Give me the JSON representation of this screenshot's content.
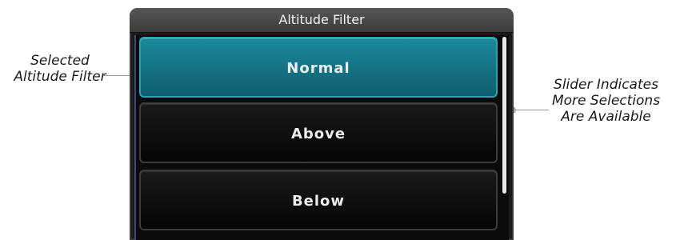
{
  "annotations": {
    "left_lines": [
      "Selected",
      "Altitude Filter"
    ],
    "right_lines": [
      "Slider Indicates",
      "More Selections",
      "Are Available"
    ]
  },
  "dialog": {
    "title": "Altitude Filter",
    "options": [
      {
        "label": "Normal",
        "selected": true
      },
      {
        "label": "Above",
        "selected": false
      },
      {
        "label": "Below",
        "selected": false
      }
    ],
    "accent_color": "#1b8a9c"
  }
}
